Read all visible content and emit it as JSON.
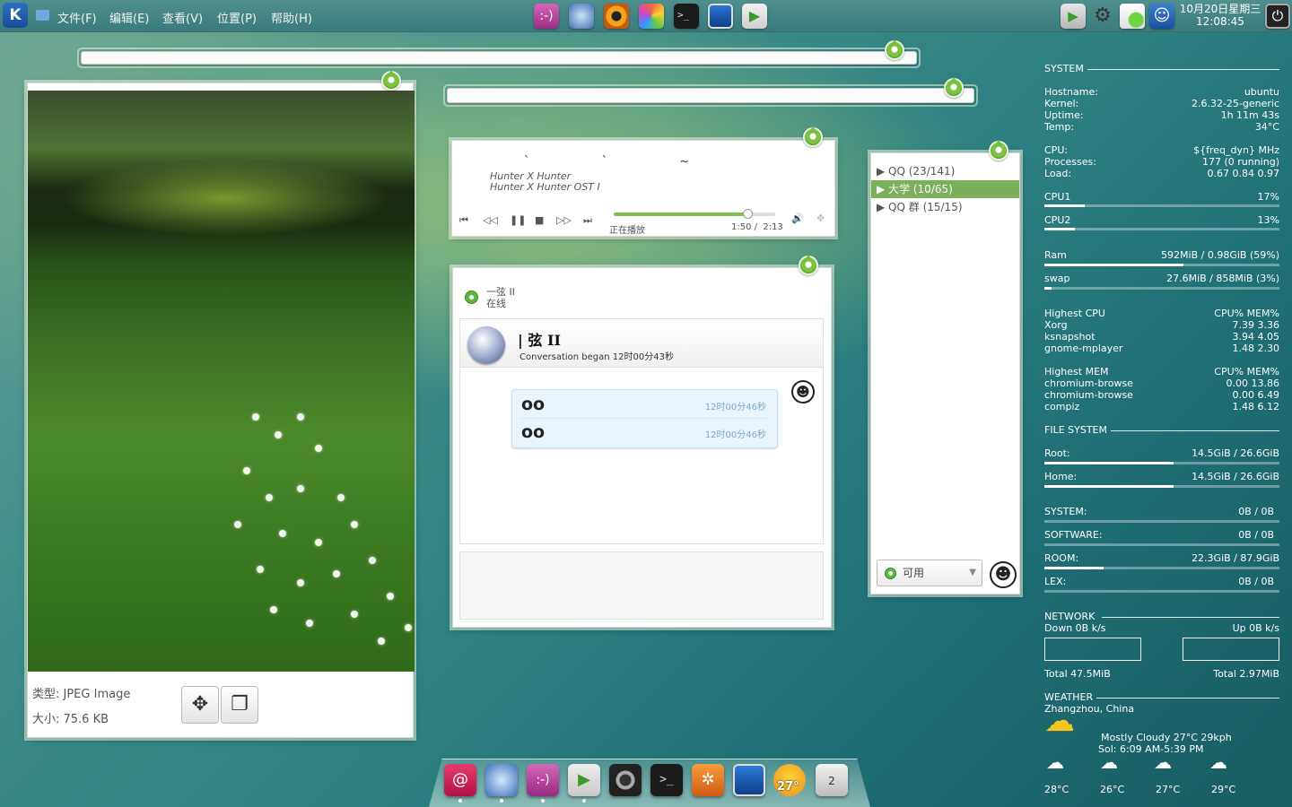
{
  "top_panel": {
    "menus": [
      "文件(F)",
      "编辑(E)",
      "查看(V)",
      "位置(P)",
      "帮助(H)"
    ],
    "launcher_icons": [
      "chat-icon",
      "browser-icon",
      "eye-icon",
      "pinwheel-icon",
      "terminal-icon",
      "monitor-icon",
      "media-player-icon"
    ],
    "tray_icons": [
      "media-player-icon",
      "settings-gear-icon",
      "network-icon",
      "accessibility-icon"
    ],
    "clock": {
      "date": "10月20日星期三",
      "time": "12:08:45"
    },
    "power_icon": "power-icon"
  },
  "image_viewer": {
    "type_label": "类型: JPEG Image",
    "size_label": "大小: 75.6 KB",
    "buttons": [
      "move-icon",
      "copy-icon"
    ]
  },
  "music_player": {
    "marks": "` ` ~",
    "artist": "Hunter X Hunter",
    "album": "Hunter X Hunter OST I",
    "status": "正在播放",
    "elapsed": "1:50 /",
    "total": "2:13",
    "progress": 0.83,
    "controls": [
      "skip-back-icon",
      "rewind-icon",
      "pause-icon",
      "stop-icon",
      "forward-icon",
      "skip-forward-icon"
    ]
  },
  "chat_window": {
    "contact_name": "一弦 II",
    "contact_status": "在线",
    "conversation_title": "| 弦 II",
    "conversation_began": "Conversation began  12时00分43秒",
    "messages": [
      {
        "text": "oo",
        "time": "12时00分46秒"
      },
      {
        "text": "oo",
        "time": "12时00分46秒"
      }
    ]
  },
  "buddy_list": {
    "groups": [
      {
        "label": "QQ  (23/141)",
        "selected": false
      },
      {
        "label": "大学 (10/65)",
        "selected": true
      },
      {
        "label": "QQ 群 (15/15)",
        "selected": false
      }
    ],
    "status": "可用"
  },
  "conky": {
    "system_title": "SYSTEM",
    "system_rows": [
      {
        "l": "Hostname:",
        "r": "ubuntu"
      },
      {
        "l": "Kernel:",
        "r": "2.6.32-25-generic"
      },
      {
        "l": "Uptime:",
        "r": "1h 11m 43s"
      },
      {
        "l": "Temp:",
        "r": "34°C"
      }
    ],
    "cpu_rows": [
      {
        "l": "CPU:",
        "r": "${freq_dyn} MHz"
      },
      {
        "l": "Processes:",
        "r": "177 (0 running)"
      },
      {
        "l": "Load:",
        "r": "0.67 0.84 0.97"
      }
    ],
    "cpu1": {
      "l": "CPU1",
      "r": "17%",
      "fill": 0.17
    },
    "cpu2": {
      "l": "CPU2",
      "r": "13%",
      "fill": 0.13
    },
    "ram": {
      "l": "Ram",
      "r": "592MiB / 0.98GiB (59%)",
      "fill": 0.59
    },
    "swap": {
      "l": "swap",
      "r": "27.6MiB / 858MiB (3%)",
      "fill": 0.03
    },
    "highest_cpu": {
      "l": "Highest CPU",
      "r": "CPU% MEM%",
      "rows": [
        {
          "l": "Xorg",
          "r": "7.39  3.36"
        },
        {
          "l": "ksnapshot",
          "r": "3.94  4.05"
        },
        {
          "l": "gnome-mplayer",
          "r": "1.48  2.30"
        }
      ]
    },
    "highest_mem": {
      "l": "Highest MEM",
      "r": "CPU% MEM%",
      "rows": [
        {
          "l": "chromium-browse",
          "r": "0.00 13.86"
        },
        {
          "l": "chromium-browse",
          "r": "0.00  6.49"
        },
        {
          "l": "compiz",
          "r": "1.48  6.12"
        }
      ]
    },
    "fs_title": "FILE SYSTEM",
    "fs": [
      {
        "l": "Root:",
        "r": "14.5GiB / 26.6GiB",
        "fill": 0.55
      },
      {
        "l": "Home:",
        "r": "14.5GiB / 26.6GiB",
        "fill": 0.55
      }
    ],
    "drives": [
      {
        "l": "SYSTEM:",
        "r": "0B   / 0B",
        "fill": 0
      },
      {
        "l": "SOFTWARE:",
        "r": "0B   / 0B",
        "fill": 0
      },
      {
        "l": "ROOM:",
        "r": "22.3GiB / 87.9GiB",
        "fill": 0.25
      },
      {
        "l": "LEX:",
        "r": "0B   / 0B",
        "fill": 0
      }
    ],
    "network_title": "NETWORK",
    "down": "Down 0B   k/s",
    "up": "Up 0B   k/s",
    "total_down": "Total 47.5MiB",
    "total_up": "Total 2.97MiB",
    "weather_title": "WEATHER",
    "location": "Zhangzhou, China",
    "current": "Mostly Cloudy   27°C   29kph",
    "sun": "Sol: 6:09 AM-5:39 PM",
    "forecast": [
      "28°C",
      "26°C",
      "27°C",
      "29°C"
    ]
  },
  "dock": {
    "icons": [
      "debian-icon",
      "browser-icon",
      "chat-icon",
      "media-player-icon",
      "camera-icon",
      "terminal-icon",
      "ubuntu-icon",
      "monitor-icon",
      "weather-icon",
      "phone-icon"
    ],
    "weather_badge": "27°",
    "phone_badge": "2"
  }
}
